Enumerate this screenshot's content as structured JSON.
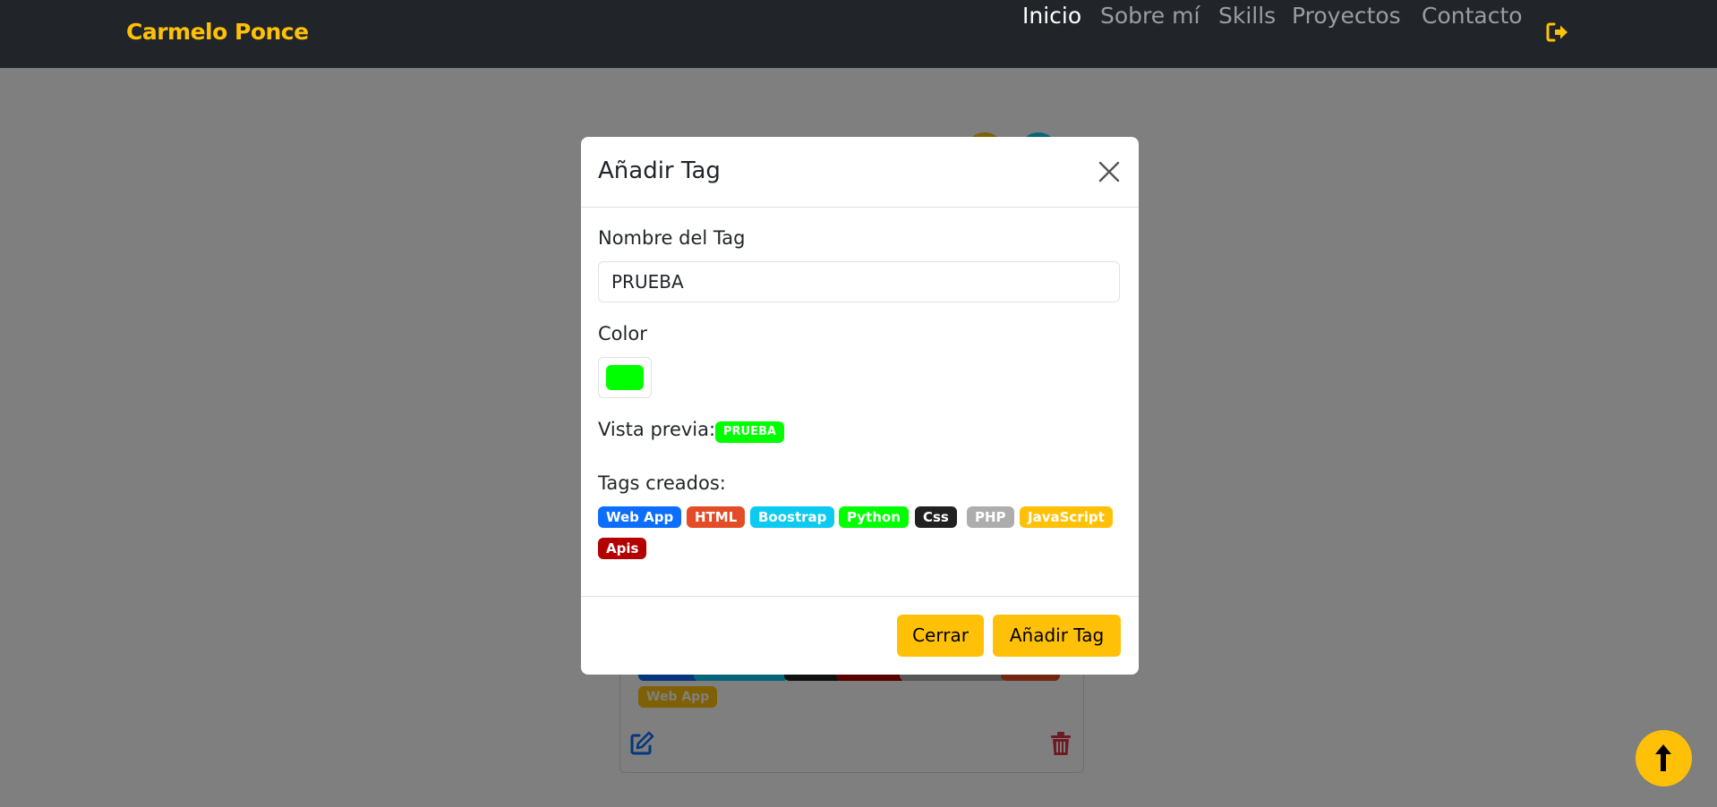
{
  "navbar": {
    "brand": "Carmelo Ponce",
    "links": [
      {
        "label": "Inicio",
        "active": true
      },
      {
        "label": "Sobre mí",
        "active": false
      },
      {
        "label": "Skills",
        "active": false
      },
      {
        "label": "Proyectos",
        "active": false
      },
      {
        "label": "Contacto",
        "active": false
      }
    ],
    "logout_icon": "sign-out-icon"
  },
  "modal": {
    "title": "Añadir Tag",
    "close_icon": "close-icon",
    "name_label": "Nombre del Tag",
    "name_value": "PRUEBA",
    "color_label": "Color",
    "color_value": "#00ff00",
    "preview_label": "Vista previa:",
    "preview_tag": "PRUEBA",
    "created_label": "Tags creados:",
    "created_tags": [
      {
        "label": "Web App",
        "color": "#0d6efd"
      },
      {
        "label": "HTML",
        "color": "#e34c26"
      },
      {
        "label": "Boostrap",
        "color": "#0dcaf0"
      },
      {
        "label": "Python",
        "color": "#00ff00"
      },
      {
        "label": "Css",
        "color": "#212121"
      },
      {
        "label": "PHP",
        "color": "#adadad"
      },
      {
        "label": "JavaScript",
        "color": "#ffc107"
      },
      {
        "label": "Apis",
        "color": "#b30000"
      }
    ],
    "cancel_label": "Cerrar",
    "submit_label": "Añadir Tag"
  },
  "background_card": {
    "visible_badge": "Web App",
    "edit_icon": "edit-icon",
    "delete_icon": "trash-icon"
  },
  "scroll_top_icon": "arrow-up-icon",
  "colors": {
    "accent": "#ffc107",
    "navbar_bg": "#212529"
  }
}
